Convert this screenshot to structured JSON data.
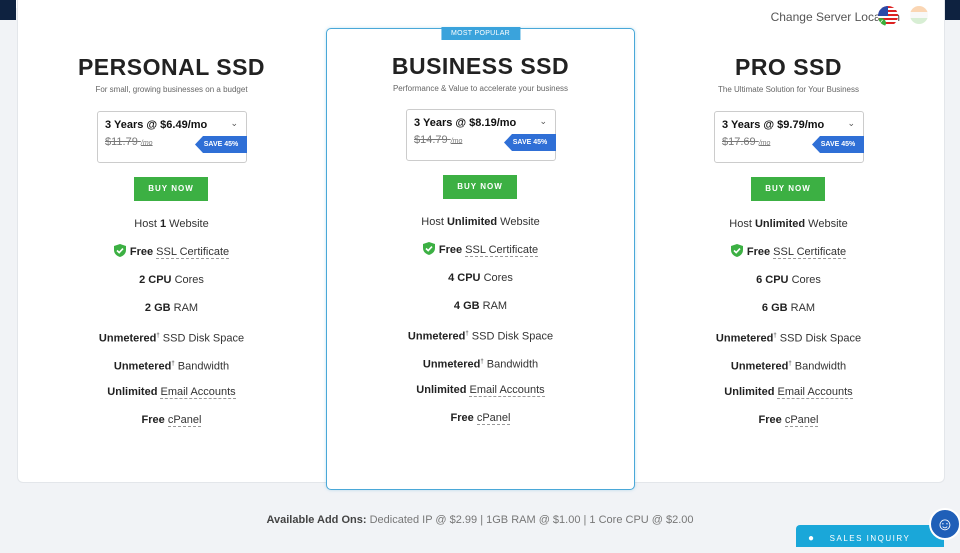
{
  "header": {
    "change_server_location": "Change Server Location",
    "flag_us_icon": "us-flag-icon",
    "flag_in_icon": "india-flag-icon"
  },
  "plans": [
    {
      "title": "PERSONAL SSD",
      "subtitle": "For small, growing businesses on a budget",
      "selected_term": "3 Years @ $6.49/mo",
      "old_price": "$11.79",
      "old_unit": "/mo",
      "save": "SAVE 45%",
      "buy": "BUY NOW",
      "features": {
        "host_pre": "Host",
        "host_val": "1",
        "host_post": "Website",
        "ssl_pre": "Free",
        "ssl_post": "SSL Certificate",
        "cpu_val": "2 CPU",
        "cpu_post": "Cores",
        "ram_val": "2 GB",
        "ram_post": "RAM",
        "disk_val": "Unmetered",
        "disk_post": "SSD Disk Space",
        "bw_val": "Unmetered",
        "bw_post": "Bandwidth",
        "email_val": "Unlimited",
        "email_post": "Email Accounts",
        "cpanel_val": "Free",
        "cpanel_post": "cPanel"
      }
    },
    {
      "ribbon": "MOST POPULAR",
      "title": "BUSINESS SSD",
      "subtitle": "Performance & Value to accelerate your business",
      "selected_term": "3 Years @ $8.19/mo",
      "old_price": "$14.79",
      "old_unit": "/mo",
      "save": "SAVE 45%",
      "buy": "BUY NOW",
      "features": {
        "host_pre": "Host",
        "host_val": "Unlimited",
        "host_post": "Website",
        "ssl_pre": "Free",
        "ssl_post": "SSL Certificate",
        "cpu_val": "4 CPU",
        "cpu_post": "Cores",
        "ram_val": "4 GB",
        "ram_post": "RAM",
        "disk_val": "Unmetered",
        "disk_post": "SSD Disk Space",
        "bw_val": "Unmetered",
        "bw_post": "Bandwidth",
        "email_val": "Unlimited",
        "email_post": "Email Accounts",
        "cpanel_val": "Free",
        "cpanel_post": "cPanel"
      }
    },
    {
      "title": "PRO SSD",
      "subtitle": "The Ultimate Solution for Your Business",
      "selected_term": "3 Years @ $9.79/mo",
      "old_price": "$17.69",
      "old_unit": "/mo",
      "save": "SAVE 45%",
      "buy": "BUY NOW",
      "features": {
        "host_pre": "Host",
        "host_val": "Unlimited",
        "host_post": "Website",
        "ssl_pre": "Free",
        "ssl_post": "SSL Certificate",
        "cpu_val": "6 CPU",
        "cpu_post": "Cores",
        "ram_val": "6 GB",
        "ram_post": "RAM",
        "disk_val": "Unmetered",
        "disk_post": "SSD Disk Space",
        "bw_val": "Unmetered",
        "bw_post": "Bandwidth",
        "email_val": "Unlimited",
        "email_post": "Email Accounts",
        "cpanel_val": "Free",
        "cpanel_post": "cPanel"
      }
    }
  ],
  "addons": {
    "label": "Available Add Ons:",
    "text": "Dedicated IP @ $2.99 | 1GB RAM @ $1.00 | 1 Core CPU @ $2.00"
  },
  "sales_inquiry": "SALES INQUIRY",
  "colors": {
    "buy_green": "#3cb043",
    "save_blue": "#2f6fd6",
    "featured_border": "#4aa8d8",
    "sales_blue": "#1aa7d9"
  }
}
